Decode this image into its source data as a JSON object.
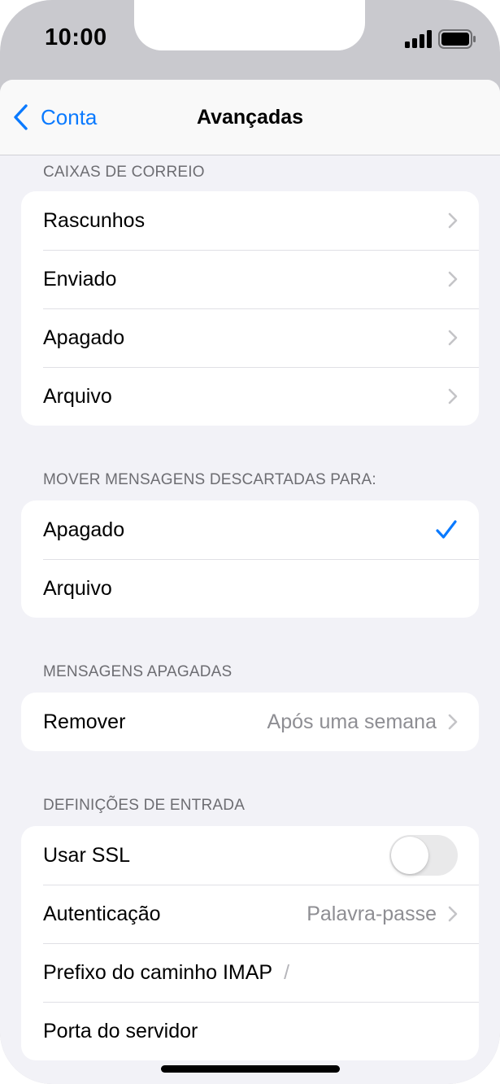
{
  "status_bar": {
    "time": "10:00",
    "signal_icon": "cellular-signal-icon",
    "battery_icon": "battery-full-icon"
  },
  "nav": {
    "back_label": "Conta",
    "title": "Avançadas"
  },
  "mailboxes": {
    "header": "CAIXAS DE CORREIO",
    "items": [
      {
        "label": "Rascunhos"
      },
      {
        "label": "Enviado"
      },
      {
        "label": "Apagado"
      },
      {
        "label": "Arquivo"
      }
    ]
  },
  "move_discarded": {
    "header": "MOVER MENSAGENS DESCARTADAS PARA:",
    "items": [
      {
        "label": "Apagado",
        "selected": true
      },
      {
        "label": "Arquivo",
        "selected": false
      }
    ]
  },
  "deleted_messages": {
    "header": "MENSAGENS APAGADAS",
    "remove_label": "Remover",
    "remove_value": "Após uma semana"
  },
  "incoming_settings": {
    "header": "DEFINIÇÕES DE ENTRADA",
    "ssl_label": "Usar SSL",
    "ssl_on": false,
    "auth_label": "Autenticação",
    "auth_value": "Palavra-passe",
    "imap_prefix_label": "Prefixo do caminho IMAP",
    "imap_prefix_value": "/",
    "port_label": "Porta do servidor"
  },
  "colors": {
    "accent": "#0a7aff",
    "background": "#f2f2f7",
    "secondary_text": "#8e8e93"
  }
}
